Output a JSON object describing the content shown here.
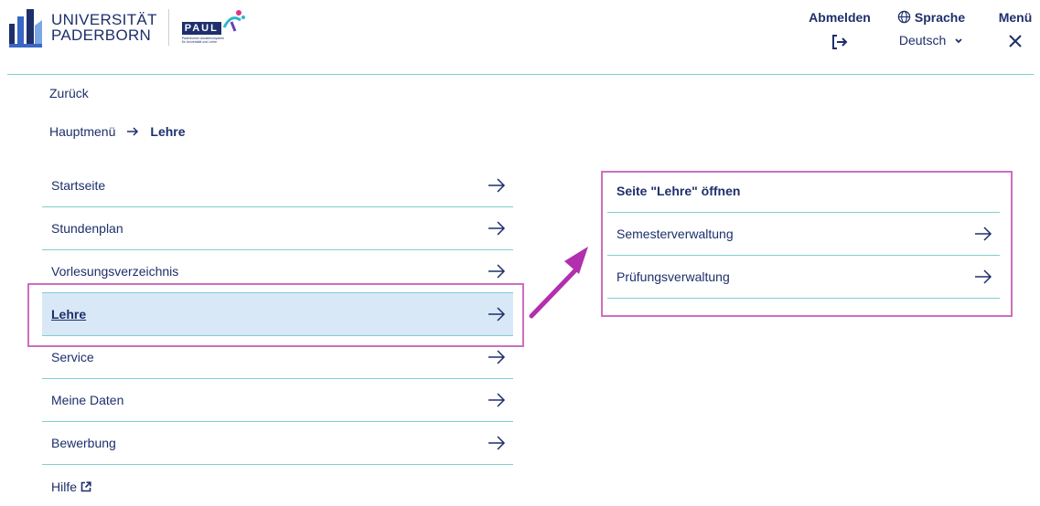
{
  "header": {
    "university_line1": "UNIVERSITÄT",
    "university_line2": "PADERBORN",
    "paul_logo_text": "PAUL",
    "paul_tagline_1": "Paderborner Assistenzsystem",
    "paul_tagline_2": "für Universität und Lehre",
    "logout_label": "Abmelden",
    "logout_icon": "logout-icon",
    "language_label": "Sprache",
    "language_icon": "globe-icon",
    "language_value": "Deutsch",
    "menu_label": "Menü",
    "menu_icon": "close-icon"
  },
  "nav": {
    "back_label": "Zurück",
    "breadcrumb": {
      "root": "Hauptmenü",
      "current": "Lehre"
    },
    "items": [
      {
        "label": "Startseite"
      },
      {
        "label": "Stundenplan"
      },
      {
        "label": "Vorlesungsverzeichnis"
      },
      {
        "label": "Lehre"
      },
      {
        "label": "Service"
      },
      {
        "label": "Meine Daten"
      },
      {
        "label": "Bewerbung"
      },
      {
        "label": "Hilfe"
      }
    ]
  },
  "submenu": {
    "open_page_label": "Seite \"Lehre\" öffnen",
    "items": [
      {
        "label": "Semesterverwaltung"
      },
      {
        "label": "Prüfungsverwaltung"
      }
    ]
  },
  "colors": {
    "brand_blue": "#1e2f6b",
    "divider": "#7fcfd2",
    "active_bg": "#d9e8f6",
    "highlight": "#cc6fbe"
  }
}
